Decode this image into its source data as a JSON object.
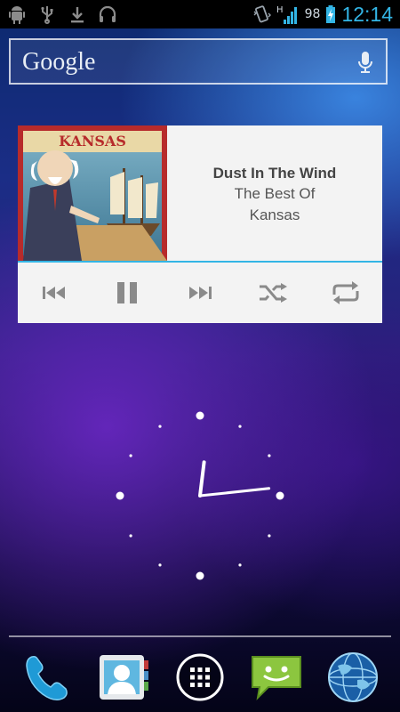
{
  "status_bar": {
    "left_icons": [
      "android-debug-icon",
      "usb-icon",
      "download-icon",
      "headset-icon"
    ],
    "network_type": "H",
    "battery_level": "98",
    "time": "12:14"
  },
  "search": {
    "logo_text": "Google",
    "mic_icon": "microphone-icon"
  },
  "music_widget": {
    "album_art_text": "KANSAS",
    "song_title": "Dust In The Wind",
    "album": "The Best Of",
    "artist": "Kansas",
    "controls": [
      "previous-icon",
      "pause-icon",
      "next-icon",
      "shuffle-icon",
      "repeat-icon"
    ],
    "accent_color": "#33b5e5"
  },
  "clock": {
    "hour": 12,
    "minute": 14,
    "second": 0
  },
  "dock": {
    "items": [
      "phone-icon",
      "contacts-icon",
      "all-apps-icon",
      "messaging-icon",
      "browser-icon"
    ]
  }
}
